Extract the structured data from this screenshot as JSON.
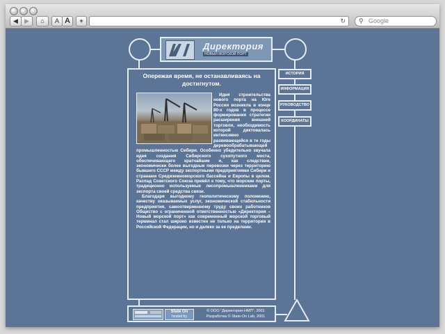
{
  "browser": {
    "nav_back": "◀",
    "nav_forward": "▶",
    "home_glyph": "⌂",
    "font_small": "A",
    "font_large": "A",
    "add_glyph": "+",
    "reload_glyph": "↻",
    "search_placeholder": "Google",
    "search_icon": "magnifier-icon"
  },
  "site": {
    "logo_name": "Директория",
    "logo_sub": "НОВЫЙ МОРСКОЙ ПОРТ",
    "headline": "Опережая время, не останавливаясь на достигнутом.",
    "intro": "Идея строительства нового порта на Юге России возникла в конце 80-х годов в процессе формирования стратегии расширения внешней торговли, необходимость которой диктовалась интенсивно развивающейся в те годы деревообрабатывающей промышленностью Сибири. Особенно убедительно звучала идея создания Сибирского сухопутного моста, обеспечивающего кратчайшие и, как следствие, экономически более выгодные перевозки через территорию бывшего СССР между экспортными предприятиями Сибири и странами Средиземноморского бассейна и Европы в целом. Распад Советского Союза привёл к тому, что морские порты, традиционно используемые лесопромышленниками для экспорта своей средства связи.",
    "para2": "Благодаря выгодному геополитическому положению, качеству оказываемых услуг, экономической стабильности предприятия, самоотверженному труду своих работников Общество с ограниченной ответственностью «Директория – Новый морской порт» как современный морской торговый терминал стал широко известен не только на территории в Российской Федерации, но и далеко за ее пределами.",
    "nav": [
      {
        "label": "ИСТОРИЯ"
      },
      {
        "label": "ИНФОРМАЦИЯ"
      },
      {
        "label": "РУКОВОДСТВО"
      },
      {
        "label": "КООРДИНАТЫ"
      }
    ],
    "footer": {
      "badge2_line1": "State On",
      "badge2_line2": "hosted by",
      "copyright": "© ООО \"Директория-НМП\", 2001",
      "developer": "Разработка © State-On Lab, 2001"
    },
    "colors": {
      "background": "#5c7495",
      "lines": "#e6edf5",
      "text": "#ffffff"
    }
  }
}
